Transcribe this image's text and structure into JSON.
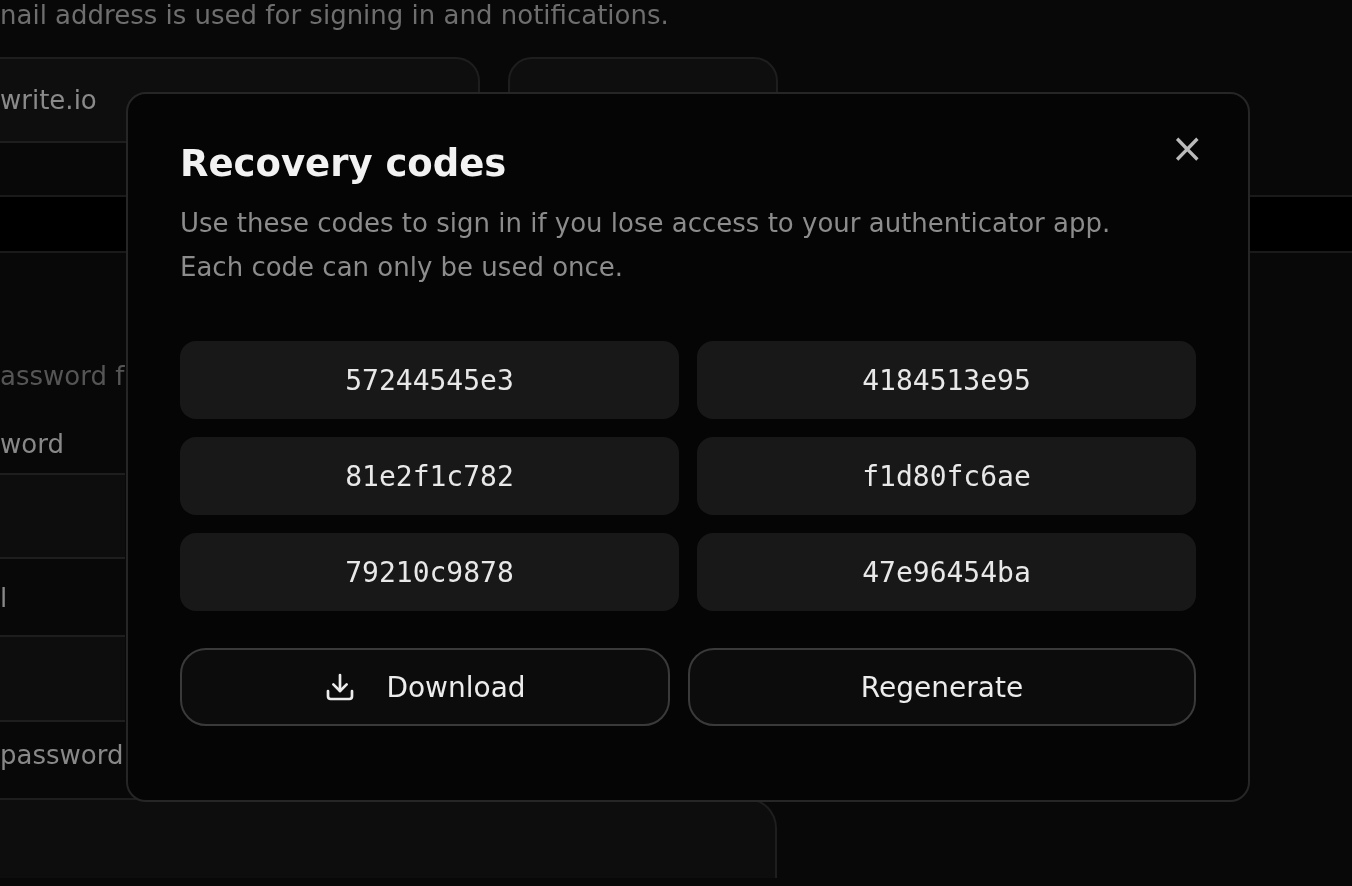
{
  "background": {
    "email_hint": "nail address is used for signing in and notifications.",
    "email_value": "write.io",
    "password_hint": "assword f",
    "labels": [
      "word",
      "l",
      "password"
    ]
  },
  "dialog": {
    "title": "Recovery codes",
    "close": "×",
    "description": "Use these codes to sign in if you lose access to your authenticator app. Each code can only be used once.",
    "codes": [
      "57244545e3",
      "4184513e95",
      "81e2f1c782",
      "f1d80fc6ae",
      "79210c9878",
      "47e96454ba"
    ],
    "buttons": [
      {
        "kind": "download",
        "label": "Download"
      },
      {
        "kind": "plain",
        "label": "Regenerate"
      }
    ]
  }
}
